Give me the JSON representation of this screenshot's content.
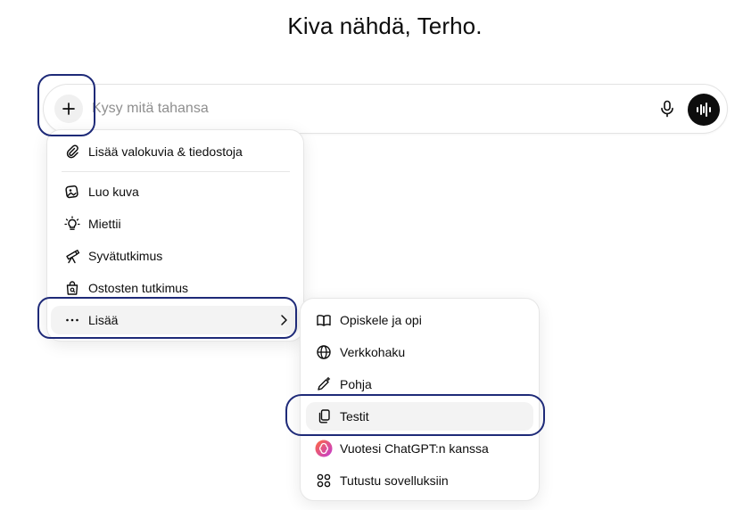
{
  "greeting": "Kiva nähdä, Terho.",
  "composer": {
    "placeholder": "Kysy mitä tahansa",
    "value": ""
  },
  "menu": {
    "items": [
      {
        "label": "Lisää valokuvia & tiedostoja",
        "icon": "paperclip-icon"
      },
      {
        "label": "Luo kuva",
        "icon": "image-icon"
      },
      {
        "label": "Miettii",
        "icon": "lightbulb-icon"
      },
      {
        "label": "Syvätutkimus",
        "icon": "telescope-icon"
      },
      {
        "label": "Ostosten tutkimus",
        "icon": "shopping-bag-icon"
      },
      {
        "label": "Lisää",
        "icon": "more-dots-icon",
        "submenu": true
      }
    ]
  },
  "submenu": {
    "items": [
      {
        "label": "Opiskele ja opi",
        "icon": "book-icon"
      },
      {
        "label": "Verkkohaku",
        "icon": "globe-icon"
      },
      {
        "label": "Pohja",
        "icon": "pen-sparkle-icon"
      },
      {
        "label": "Testit",
        "icon": "cards-icon",
        "active": true
      },
      {
        "label": "Vuotesi ChatGPT:n kanssa",
        "icon": "chatgpt-year-icon"
      },
      {
        "label": "Tutustu sovelluksiin",
        "icon": "apps-grid-icon"
      }
    ]
  },
  "colors": {
    "highlight": "#1e2a78",
    "accent_gradient": [
      "#ff6a3d",
      "#c23ad6"
    ]
  }
}
